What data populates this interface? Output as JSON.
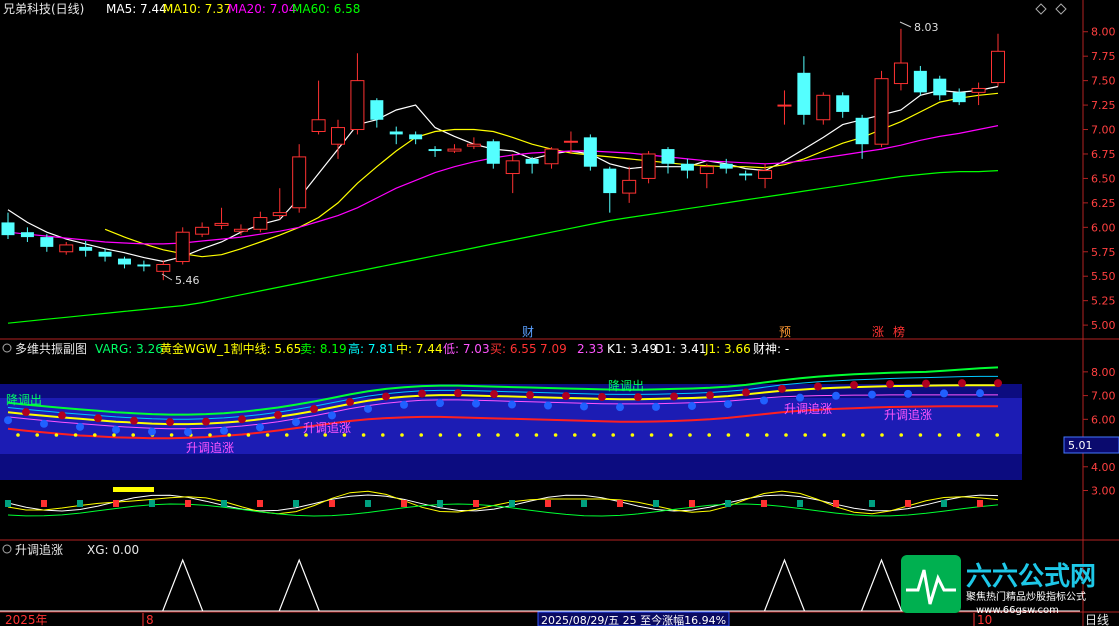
{
  "main_header": {
    "stock": "兄弟科技(日线)",
    "ma5": "MA5: 7.44",
    "ma10": "MA10: 7.37",
    "ma20": "MA20: 7.04",
    "ma60": "MA60: 6.58"
  },
  "main_annotations": {
    "high": "8.03",
    "low": "5.46"
  },
  "event_markers": [
    "财",
    "预",
    "涨",
    "榜"
  ],
  "sub_header": {
    "title": "多维共振副图",
    "varg": "VARG: 3.26",
    "golden": "黄金WGW_1割中线: 5.65",
    "sell": "卖: 8.19",
    "high": "高: 7.81",
    "mid": "中: 7.44",
    "low": "低: 7.03",
    "buy": "买: 6.55",
    "v7": "7.09",
    "v8": "2.33",
    "k1": "K1: 3.49",
    "d1": "D1: 3.41",
    "j1": "J1: 3.66",
    "cs": "财神: -"
  },
  "sub_labels": {
    "down": "降调出",
    "up": "升调追涨"
  },
  "sub_value_box": "5.01",
  "bottom_header": {
    "title": "升调追涨",
    "xg": "XG: 0.00"
  },
  "footer": {
    "year": "2025年",
    "month": "8",
    "info": "2025/08/29/五 25 至今涨幅16.94%",
    "next_month": "10",
    "period": "日线"
  },
  "watermark": {
    "brand": "六六公式网",
    "slogan": "聚焦热门精品炒股指标公式",
    "url": "www.66gsw.com"
  },
  "colors": {
    "up": "#ff3232",
    "down": "#54ffff",
    "ma5": "#ffffff",
    "ma10": "#ffff00",
    "ma20": "#ff00ff",
    "ma60": "#00ff00",
    "band": "#1010a0"
  },
  "chart_data": [
    {
      "type": "candlestick",
      "title": "兄弟科技(日线)",
      "yticks": [
        "8.00",
        "7.75",
        "7.50",
        "7.25",
        "7.00",
        "6.75",
        "6.50",
        "6.25",
        "6.00",
        "5.75",
        "5.50",
        "5.25",
        "5.00"
      ],
      "ylim": [
        4.95,
        8.12
      ],
      "candles": [
        {
          "o": 6.05,
          "c": 5.92,
          "h": 6.15,
          "l": 5.88
        },
        {
          "o": 5.95,
          "c": 5.9,
          "h": 6.0,
          "l": 5.85
        },
        {
          "o": 5.9,
          "c": 5.8,
          "h": 5.93,
          "l": 5.75
        },
        {
          "o": 5.75,
          "c": 5.82,
          "h": 5.85,
          "l": 5.72
        },
        {
          "o": 5.8,
          "c": 5.76,
          "h": 5.86,
          "l": 5.7
        },
        {
          "o": 5.75,
          "c": 5.7,
          "h": 5.78,
          "l": 5.65
        },
        {
          "o": 5.68,
          "c": 5.62,
          "h": 5.7,
          "l": 5.58
        },
        {
          "o": 5.62,
          "c": 5.6,
          "h": 5.66,
          "l": 5.55
        },
        {
          "o": 5.55,
          "c": 5.62,
          "h": 5.66,
          "l": 5.46
        },
        {
          "o": 5.65,
          "c": 5.95,
          "h": 6.0,
          "l": 5.62
        },
        {
          "o": 5.93,
          "c": 6.0,
          "h": 6.05,
          "l": 5.9
        },
        {
          "o": 6.02,
          "c": 6.04,
          "h": 6.2,
          "l": 5.98
        },
        {
          "o": 5.96,
          "c": 5.98,
          "h": 6.03,
          "l": 5.92
        },
        {
          "o": 5.98,
          "c": 6.1,
          "h": 6.16,
          "l": 5.95
        },
        {
          "o": 6.12,
          "c": 6.15,
          "h": 6.4,
          "l": 6.08
        },
        {
          "o": 6.2,
          "c": 6.72,
          "h": 6.85,
          "l": 6.15
        },
        {
          "o": 6.98,
          "c": 7.1,
          "h": 7.5,
          "l": 6.95
        },
        {
          "o": 6.85,
          "c": 7.02,
          "h": 7.1,
          "l": 6.7
        },
        {
          "o": 7.0,
          "c": 7.5,
          "h": 7.78,
          "l": 6.95
        },
        {
          "o": 7.3,
          "c": 7.1,
          "h": 7.32,
          "l": 7.02
        },
        {
          "o": 6.98,
          "c": 6.95,
          "h": 7.03,
          "l": 6.85
        },
        {
          "o": 6.95,
          "c": 6.9,
          "h": 6.98,
          "l": 6.85
        },
        {
          "o": 6.8,
          "c": 6.78,
          "h": 6.83,
          "l": 6.72
        },
        {
          "o": 6.78,
          "c": 6.8,
          "h": 6.85,
          "l": 6.76
        },
        {
          "o": 6.83,
          "c": 6.85,
          "h": 6.92,
          "l": 6.8
        },
        {
          "o": 6.88,
          "c": 6.65,
          "h": 6.9,
          "l": 6.6
        },
        {
          "o": 6.55,
          "c": 6.68,
          "h": 6.75,
          "l": 6.35
        },
        {
          "o": 6.7,
          "c": 6.65,
          "h": 6.72,
          "l": 6.55
        },
        {
          "o": 6.65,
          "c": 6.8,
          "h": 6.82,
          "l": 6.6
        },
        {
          "o": 6.88,
          "c": 6.88,
          "h": 6.98,
          "l": 6.75
        },
        {
          "o": 6.92,
          "c": 6.62,
          "h": 6.95,
          "l": 6.58
        },
        {
          "o": 6.6,
          "c": 6.35,
          "h": 6.62,
          "l": 6.15
        },
        {
          "o": 6.35,
          "c": 6.48,
          "h": 6.62,
          "l": 6.25
        },
        {
          "o": 6.5,
          "c": 6.75,
          "h": 6.78,
          "l": 6.45
        },
        {
          "o": 6.8,
          "c": 6.65,
          "h": 6.82,
          "l": 6.55
        },
        {
          "o": 6.65,
          "c": 6.58,
          "h": 6.7,
          "l": 6.5
        },
        {
          "o": 6.55,
          "c": 6.62,
          "h": 6.65,
          "l": 6.4
        },
        {
          "o": 6.65,
          "c": 6.6,
          "h": 6.7,
          "l": 6.55
        },
        {
          "o": 6.55,
          "c": 6.53,
          "h": 6.58,
          "l": 6.48
        },
        {
          "o": 6.5,
          "c": 6.58,
          "h": 6.65,
          "l": 6.4
        },
        {
          "o": 7.25,
          "c": 7.25,
          "h": 7.4,
          "l": 7.05
        },
        {
          "o": 7.58,
          "c": 7.15,
          "h": 7.75,
          "l": 7.05
        },
        {
          "o": 7.1,
          "c": 7.35,
          "h": 7.38,
          "l": 7.05
        },
        {
          "o": 7.35,
          "c": 7.18,
          "h": 7.38,
          "l": 7.12
        },
        {
          "o": 7.12,
          "c": 6.85,
          "h": 7.15,
          "l": 6.7
        },
        {
          "o": 6.85,
          "c": 7.52,
          "h": 7.6,
          "l": 6.82
        },
        {
          "o": 7.47,
          "c": 7.68,
          "h": 8.03,
          "l": 7.4
        },
        {
          "o": 7.6,
          "c": 7.38,
          "h": 7.65,
          "l": 7.35
        },
        {
          "o": 7.52,
          "c": 7.35,
          "h": 7.55,
          "l": 7.3
        },
        {
          "o": 7.38,
          "c": 7.28,
          "h": 7.42,
          "l": 7.25
        },
        {
          "o": 7.38,
          "c": 7.42,
          "h": 7.48,
          "l": 7.25
        },
        {
          "o": 7.48,
          "c": 7.8,
          "h": 7.98,
          "l": 7.44
        }
      ],
      "series": [
        {
          "name": "MA5",
          "values": [
            6.18,
            6.05,
            5.95,
            5.88,
            5.83,
            5.78,
            5.74,
            5.69,
            5.65,
            5.7,
            5.78,
            5.85,
            5.95,
            6.03,
            6.08,
            6.3,
            6.55,
            6.8,
            7.05,
            7.1,
            7.2,
            7.25,
            7.02,
            6.93,
            6.85,
            6.8,
            6.78,
            6.7,
            6.75,
            6.78,
            6.75,
            6.65,
            6.6,
            6.62,
            6.62,
            6.62,
            6.68,
            6.65,
            6.6,
            6.58,
            6.68,
            6.8,
            6.92,
            7.05,
            7.1,
            7.15,
            7.2,
            7.35,
            7.4,
            7.38,
            7.4,
            7.44
          ]
        },
        {
          "name": "MA10",
          "values": [
            null,
            null,
            null,
            null,
            null,
            5.98,
            5.9,
            5.83,
            5.77,
            5.73,
            5.7,
            5.72,
            5.78,
            5.85,
            5.92,
            6.0,
            6.1,
            6.25,
            6.45,
            6.62,
            6.78,
            6.92,
            6.98,
            7.0,
            7.0,
            6.98,
            6.92,
            6.85,
            6.8,
            6.76,
            6.74,
            6.72,
            6.7,
            6.68,
            6.66,
            6.64,
            6.63,
            6.62,
            6.62,
            6.61,
            6.64,
            6.7,
            6.78,
            6.86,
            6.92,
            7.0,
            7.08,
            7.18,
            7.28,
            7.32,
            7.35,
            7.37
          ]
        },
        {
          "name": "MA20",
          "values": [
            5.95,
            5.93,
            5.91,
            5.89,
            5.87,
            5.85,
            5.84,
            5.83,
            5.83,
            5.84,
            5.86,
            5.88,
            5.9,
            5.93,
            5.96,
            6.0,
            6.06,
            6.12,
            6.2,
            6.3,
            6.4,
            6.48,
            6.56,
            6.62,
            6.67,
            6.71,
            6.74,
            6.76,
            6.77,
            6.78,
            6.78,
            6.77,
            6.76,
            6.74,
            6.72,
            6.7,
            6.68,
            6.67,
            6.66,
            6.65,
            6.66,
            6.68,
            6.71,
            6.74,
            6.77,
            6.8,
            6.84,
            6.89,
            6.93,
            6.96,
            7.0,
            7.04
          ]
        },
        {
          "name": "MA60",
          "values": [
            5.02,
            5.04,
            5.06,
            5.08,
            5.1,
            5.12,
            5.14,
            5.16,
            5.18,
            5.2,
            5.23,
            5.27,
            5.31,
            5.35,
            5.39,
            5.43,
            5.47,
            5.51,
            5.55,
            5.59,
            5.63,
            5.67,
            5.71,
            5.75,
            5.79,
            5.83,
            5.87,
            5.91,
            5.95,
            5.99,
            6.03,
            6.07,
            6.1,
            6.13,
            6.16,
            6.19,
            6.22,
            6.25,
            6.28,
            6.31,
            6.34,
            6.37,
            6.4,
            6.43,
            6.46,
            6.49,
            6.52,
            6.54,
            6.56,
            6.57,
            6.57,
            6.58
          ]
        }
      ]
    },
    {
      "type": "line",
      "title": "多维共振副图",
      "yticks": [
        "8.00",
        "7.00",
        "6.00",
        "4.00",
        "3.00"
      ],
      "series": [
        {
          "name": "卖",
          "values": [
            6.7,
            6.62,
            6.55,
            6.48,
            6.42,
            6.36,
            6.3,
            6.26,
            6.22,
            6.2,
            6.2,
            6.22,
            6.26,
            6.32,
            6.4,
            6.5,
            6.62,
            6.75,
            6.9,
            7.05,
            7.18,
            7.28,
            7.35,
            7.4,
            7.42,
            7.42,
            7.4,
            7.38,
            7.36,
            7.34,
            7.32,
            7.3,
            7.28,
            7.26,
            7.25,
            7.25,
            7.26,
            7.28,
            7.3,
            7.33,
            7.38,
            7.45,
            7.55,
            7.65,
            7.73,
            7.8,
            7.85,
            7.9,
            7.93,
            7.96,
            7.98,
            8.0,
            8.05,
            8.1,
            8.15,
            8.19
          ]
        },
        {
          "name": "高",
          "values": [
            6.5,
            6.42,
            6.35,
            6.28,
            6.22,
            6.16,
            6.1,
            6.06,
            6.02,
            6.0,
            6.0,
            6.02,
            6.06,
            6.12,
            6.2,
            6.3,
            6.42,
            6.55,
            6.7,
            6.85,
            6.98,
            7.08,
            7.15,
            7.2,
            7.22,
            7.22,
            7.2,
            7.18,
            7.16,
            7.14,
            7.12,
            7.1,
            7.08,
            7.06,
            7.05,
            7.05,
            7.06,
            7.08,
            7.1,
            7.13,
            7.18,
            7.25,
            7.35,
            7.45,
            7.52,
            7.58,
            7.62,
            7.66,
            7.69,
            7.72,
            7.74,
            7.76,
            7.78,
            7.8,
            7.81,
            7.81
          ]
        },
        {
          "name": "中",
          "values": [
            6.3,
            6.22,
            6.15,
            6.08,
            6.02,
            5.96,
            5.9,
            5.86,
            5.82,
            5.8,
            5.8,
            5.82,
            5.86,
            5.92,
            6.0,
            6.1,
            6.22,
            6.35,
            6.5,
            6.65,
            6.78,
            6.88,
            6.95,
            7.0,
            7.02,
            7.02,
            7.0,
            6.98,
            6.96,
            6.94,
            6.92,
            6.9,
            6.88,
            6.86,
            6.85,
            6.85,
            6.86,
            6.88,
            6.9,
            6.93,
            6.98,
            7.05,
            7.13,
            7.2,
            7.25,
            7.3,
            7.33,
            7.36,
            7.38,
            7.4,
            7.41,
            7.42,
            7.43,
            7.44,
            7.44,
            7.44
          ]
        },
        {
          "name": "低",
          "values": [
            6.1,
            6.02,
            5.95,
            5.88,
            5.82,
            5.76,
            5.7,
            5.66,
            5.62,
            5.6,
            5.6,
            5.62,
            5.66,
            5.72,
            5.8,
            5.9,
            6.02,
            6.15,
            6.3,
            6.45,
            6.58,
            6.68,
            6.75,
            6.8,
            6.82,
            6.82,
            6.8,
            6.78,
            6.76,
            6.74,
            6.72,
            6.7,
            6.68,
            6.66,
            6.65,
            6.65,
            6.66,
            6.68,
            6.7,
            6.73,
            6.77,
            6.83,
            6.9,
            6.95,
            6.98,
            7.0,
            7.01,
            7.02,
            7.02,
            7.03,
            7.03,
            7.03,
            7.03,
            7.03,
            7.03,
            7.03
          ]
        },
        {
          "name": "买",
          "values": [
            5.6,
            5.52,
            5.45,
            5.38,
            5.32,
            5.28,
            5.24,
            5.22,
            5.2,
            5.2,
            5.22,
            5.25,
            5.3,
            5.36,
            5.44,
            5.53,
            5.63,
            5.73,
            5.83,
            5.93,
            6.0,
            6.05,
            6.08,
            6.1,
            6.1,
            6.08,
            6.06,
            6.04,
            6.02,
            6.0,
            5.98,
            5.96,
            5.94,
            5.92,
            5.9,
            5.9,
            5.91,
            5.93,
            5.96,
            6.0,
            6.06,
            6.14,
            6.22,
            6.3,
            6.36,
            6.4,
            6.44,
            6.47,
            6.5,
            6.52,
            6.53,
            6.54,
            6.55,
            6.55,
            6.55,
            6.55
          ]
        }
      ]
    },
    {
      "type": "line",
      "title": "升调追涨",
      "series": [
        {
          "name": "XG",
          "values": [
            0,
            0,
            0,
            0,
            0,
            0,
            0,
            0,
            0,
            1,
            0,
            0,
            0,
            0,
            0,
            1,
            0,
            0,
            0,
            0,
            0,
            0,
            0,
            0,
            0,
            0,
            0,
            0,
            0,
            0,
            0,
            0,
            0,
            0,
            0,
            0,
            0,
            0,
            0,
            0,
            1,
            0,
            0,
            0,
            0,
            1,
            0,
            0,
            0,
            0,
            0,
            0
          ]
        }
      ]
    }
  ]
}
